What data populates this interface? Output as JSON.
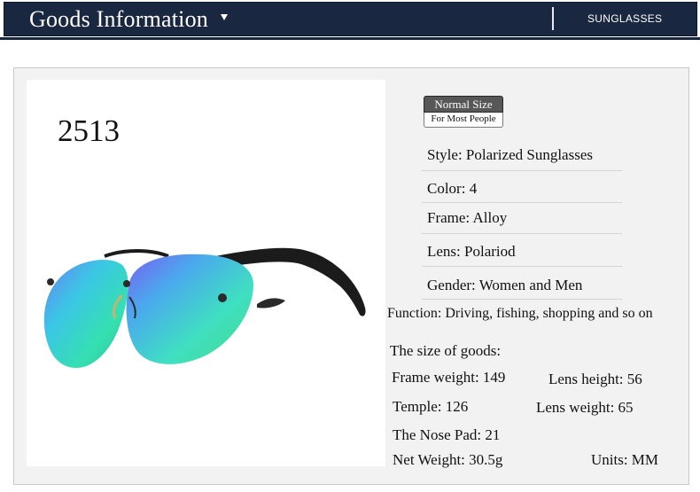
{
  "header": {
    "title": "Goods Information",
    "category": "SUNGLASSES"
  },
  "product": {
    "model": "2513",
    "lens_color_hex": "#3fd4c9"
  },
  "badge": {
    "top": "Normal Size",
    "bottom": "For Most People"
  },
  "specs": [
    {
      "label": "Style:",
      "value": "Polarized Sunglasses"
    },
    {
      "label": "Color:",
      "value": "4"
    },
    {
      "label": "Frame:",
      "value": "Alloy"
    },
    {
      "label": "Lens:",
      "value": "Polariod"
    },
    {
      "label": "Gender:",
      "value": "Women and Men"
    },
    {
      "label": "Function:",
      "value": "Driving, fishing, shopping and so on"
    }
  ],
  "size": {
    "heading": "The size of goods:",
    "frame_weight": "Frame weight: 149",
    "lens_height": "Lens height: 56",
    "temple": "Temple: 126",
    "lens_weight": "Lens weight: 65",
    "nose_pad": "The Nose Pad: 21",
    "net_weight": "Net Weight: 30.5g",
    "units": "Units: MM"
  }
}
